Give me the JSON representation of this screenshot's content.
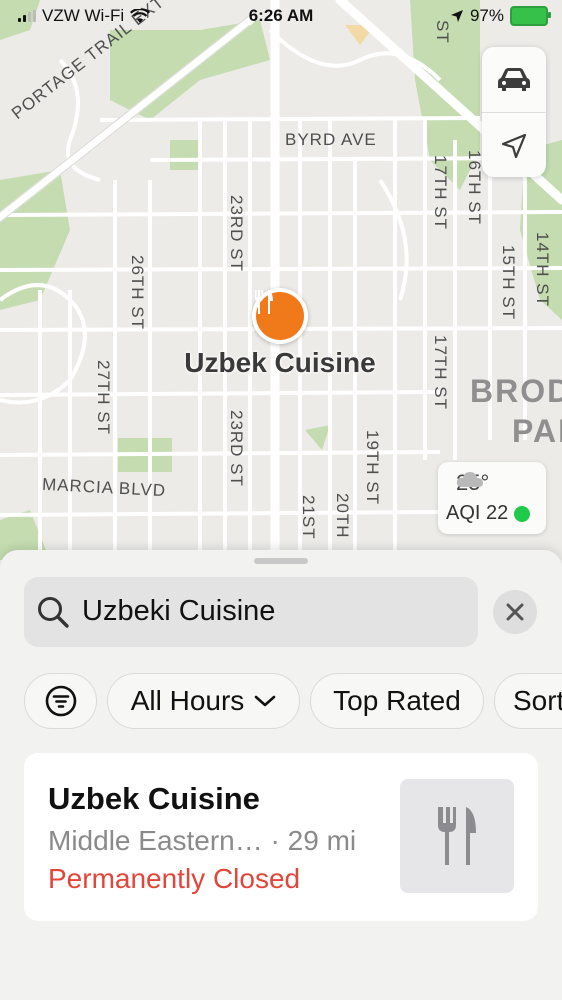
{
  "status_bar": {
    "carrier": "VZW Wi-Fi",
    "time": "6:26 AM",
    "battery_percent": "97%"
  },
  "map": {
    "streets": {
      "portage": "PORTAGE TRAIL EXT W",
      "byrd": "BYRD AVE",
      "st_top": "ST",
      "s23rd_a": "23RD ST",
      "s23rd_b": "23RD ST",
      "s26th": "26TH ST",
      "s27th": "27TH ST",
      "s17th_a": "17TH ST",
      "s17th_b": "17TH ST",
      "s16th": "16TH ST",
      "s15th": "15TH ST",
      "s14th": "14TH ST",
      "s19th": "19TH ST",
      "s20th": "20TH",
      "s21st": "21ST",
      "marcia": "MARCIA BLVD"
    },
    "district_line1": "BRODI",
    "district_line2": "PAR",
    "pin_label": "Uzbek Cuisine",
    "weather": {
      "temp": "25°",
      "aqi": "AQI 22"
    },
    "icons": {
      "driving": "car-icon",
      "location": "location-arrow-icon",
      "pin": "fork-knife-icon"
    },
    "colors": {
      "pin": "#f07a1a",
      "park": "#c4dcb0",
      "aqi_good": "#1fc94a"
    }
  },
  "search": {
    "query": "Uzbeki Cuisine"
  },
  "filters": {
    "hours": "All Hours",
    "top_rated": "Top Rated",
    "sort": "Sort"
  },
  "result": {
    "name": "Uzbek Cuisine",
    "category_distance": "Middle Eastern… · 29 mi",
    "status": "Permanently Closed",
    "status_color": "#e2463a"
  }
}
